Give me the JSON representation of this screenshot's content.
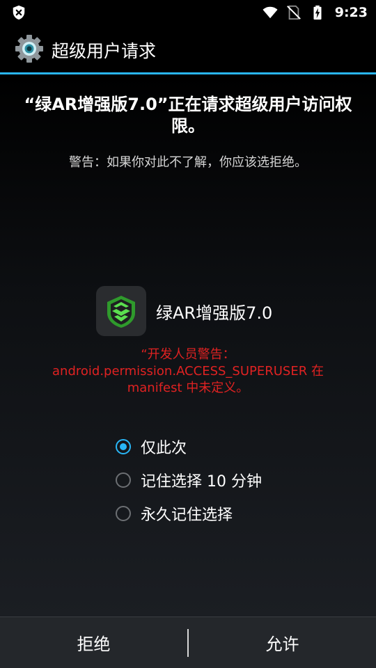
{
  "status_bar": {
    "time": "9:23",
    "icons": [
      "superuser-shield-icon",
      "wifi-icon",
      "no-sim-icon",
      "battery-charging-icon"
    ]
  },
  "action_bar": {
    "title": "超级用户请求",
    "icon": "gear-icon"
  },
  "request": {
    "title": "“绿AR增强版7.0”正在请求超级用户访问权限。",
    "warning": "警告：如果你对此不了解，你应该选拒绝。",
    "app_name": "绿AR增强版7.0",
    "developer_warning_lines": [
      "“开发人员警告：",
      "android.permission.ACCESS_SUPERUSER 在",
      "manifest 中未定义。"
    ]
  },
  "options": [
    {
      "label": "仅此次",
      "checked": true
    },
    {
      "label": "记住选择 10 分钟",
      "checked": false
    },
    {
      "label": "永久记住选择",
      "checked": false
    }
  ],
  "buttons": {
    "deny": "拒绝",
    "allow": "允许"
  },
  "colors": {
    "accent": "#29b6f6",
    "warning_red": "#e02222",
    "app_green": "#3fc93a"
  }
}
